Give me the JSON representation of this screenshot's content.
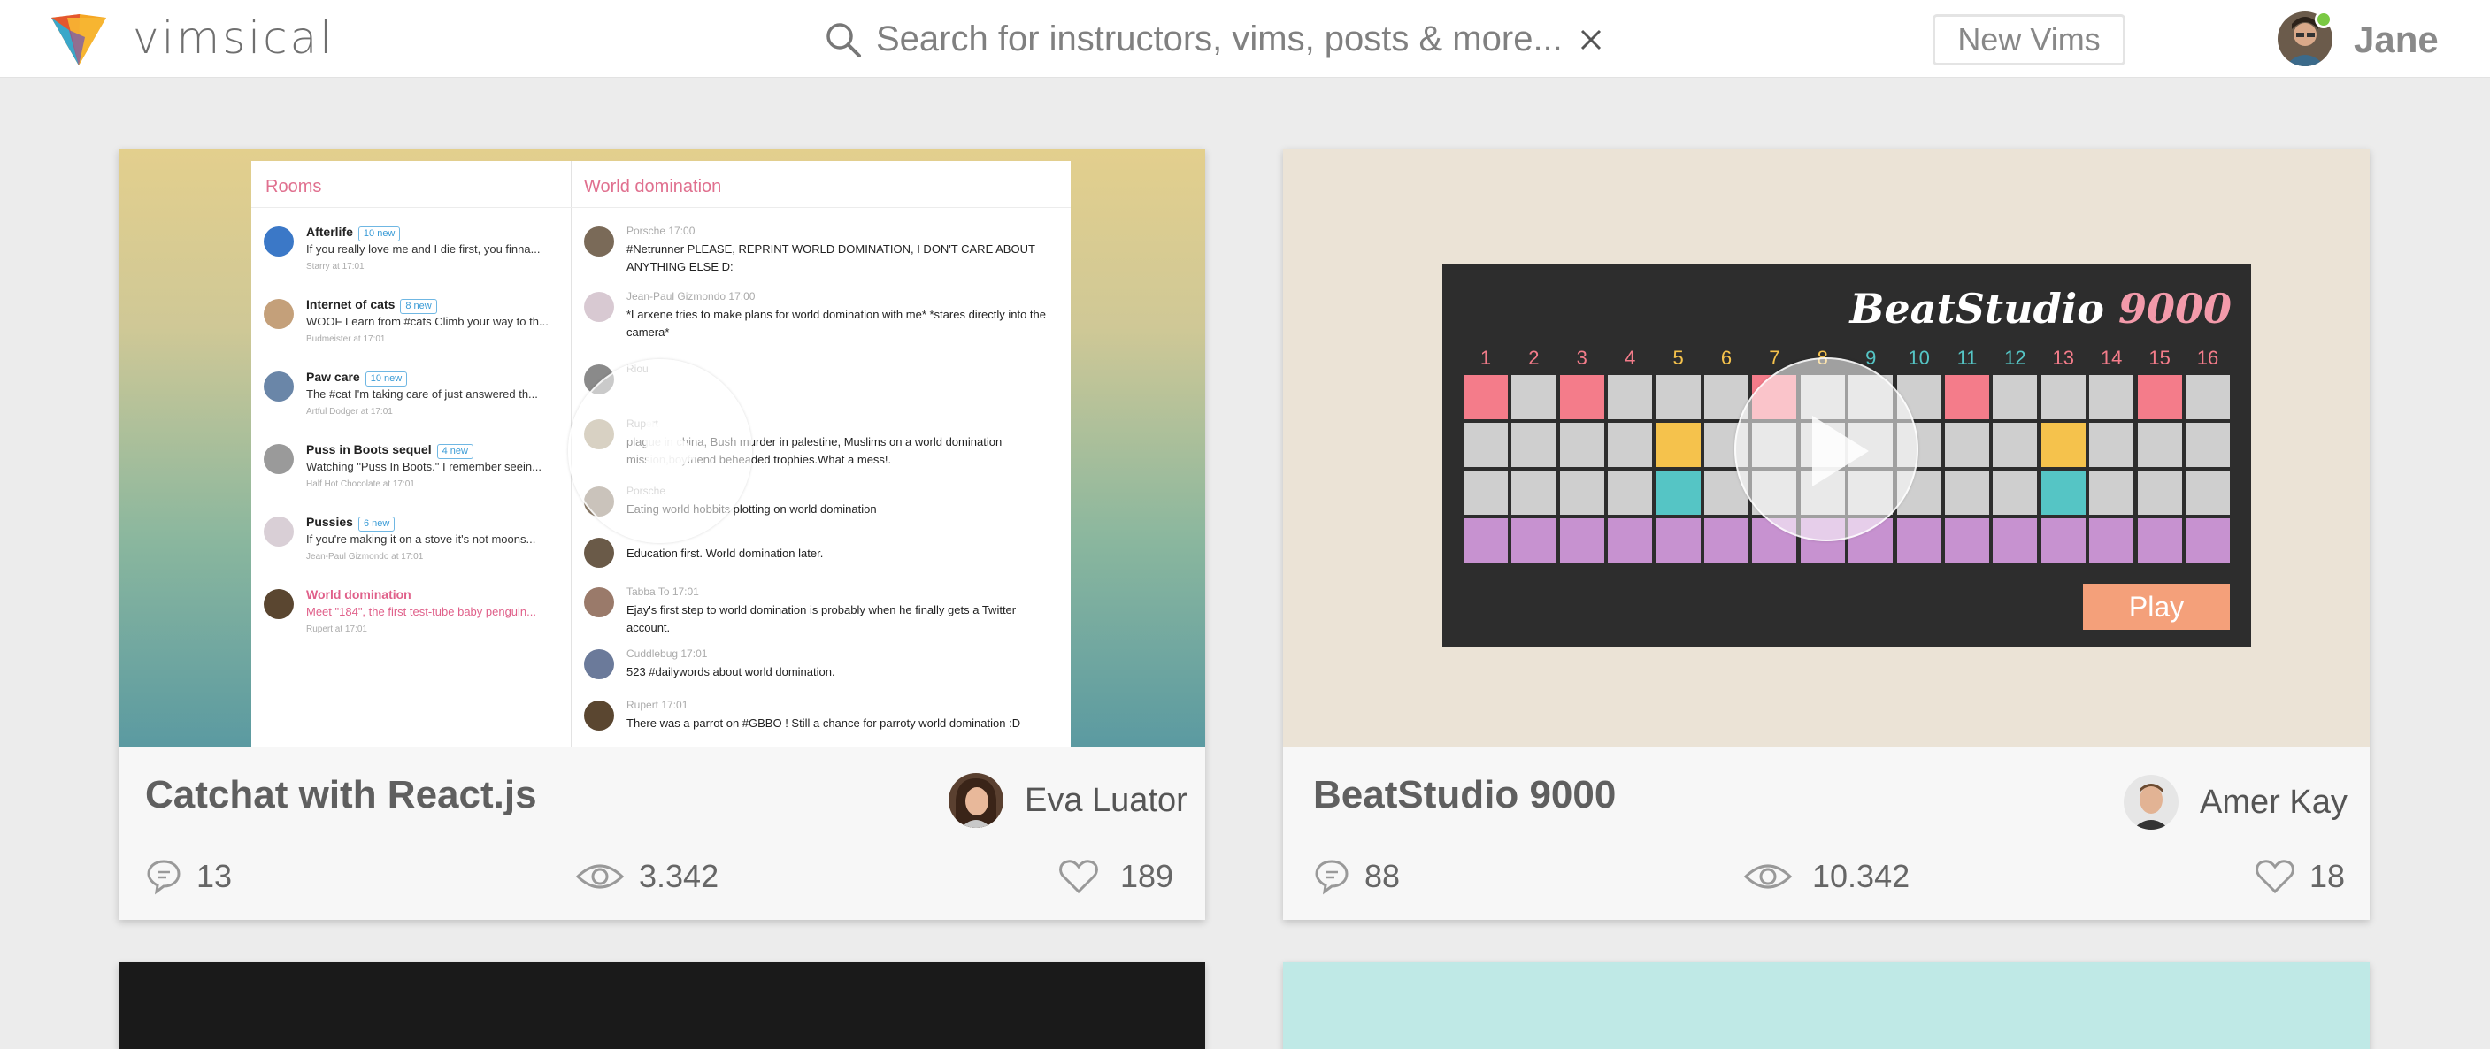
{
  "header": {
    "logo_text": "vimsical",
    "search_placeholder": "Search for instructors, vims, posts & more...",
    "new_vims_label": "New Vims",
    "user_name": "Jane"
  },
  "cards": [
    {
      "title": "Catchat with React.js",
      "author": "Eva Luator",
      "comments": "13",
      "views": "3.342",
      "likes": "189",
      "preview": {
        "rooms_header": "Rooms",
        "chat_header": "World domination",
        "rooms": [
          {
            "name": "Afterlife",
            "badge": "10 new",
            "preview": "If you really love me and I die first, you finna...",
            "meta": "Starry at 17:01",
            "color": "#3b78c7"
          },
          {
            "name": "Internet of cats",
            "badge": "8 new",
            "preview": "WOOF Learn from #cats Climb your way to th...",
            "meta": "Budmeister at 17:01",
            "color": "#c4a07a"
          },
          {
            "name": "Paw care",
            "badge": "10 new",
            "preview": "The #cat I'm taking care of just answered th...",
            "meta": "Artful Dodger at 17:01",
            "color": "#6a86a8"
          },
          {
            "name": "Puss in Boots sequel",
            "badge": "4 new",
            "preview": "Watching \"Puss In Boots.\" I remember seein...",
            "meta": "Half Hot Chocolate at 17:01",
            "color": "#9a9a9a"
          },
          {
            "name": "Pussies",
            "badge": "6 new",
            "preview": "If you're making it on a stove it's not moons...",
            "meta": "Jean-Paul Gizmondo at 17:01",
            "color": "#d9cfd6"
          },
          {
            "name": "World domination",
            "badge": "",
            "preview": "Meet \"184\", the first test-tube baby penguin...",
            "meta": "Rupert at 17:01",
            "color": "#5a4630"
          }
        ],
        "messages": [
          {
            "author": "Porsche 17:00",
            "text": "#Netrunner PLEASE, REPRINT WORLD DOMINATION, I DON'T CARE ABOUT ANYTHING ELSE D:",
            "color": "#7a6a58"
          },
          {
            "author": "Jean-Paul Gizmondo 17:00",
            "text": "*Larxene tries to make plans for world domination with me* *stares directly into the camera*",
            "color": "#d8c9d2"
          },
          {
            "author": "Riou",
            "text": "",
            "color": "#8a8a8a"
          },
          {
            "author": "Rupert",
            "text": "plague in china, Bush murder in palestine, Muslims on a world domination mission,boyfriend beheaded trophies.What a mess!.",
            "color": "#a89a7a"
          },
          {
            "author": "Porsche",
            "text": "Eating world hobbits plotting on world domination",
            "color": "#8a7a68"
          },
          {
            "author": "",
            "text": "Education first. World domination later.",
            "color": "#6a5a48"
          },
          {
            "author": "Tabba To 17:01",
            "text": "Ejay's first step to world domination is probably when he finally gets a Twitter account.",
            "color": "#9a7a6a"
          },
          {
            "author": "Cuddlebug 17:01",
            "text": "523 #dailywords about world domination.",
            "color": "#6b7a9a"
          },
          {
            "author": "Rupert 17:01",
            "text": "There was a parrot on #GBBO ! Still a chance for parroty world domination :D",
            "color": "#5a4630"
          }
        ]
      }
    },
    {
      "title": "BeatStudio 9000",
      "author": "Amer Kay",
      "comments": "88",
      "views": "10.342",
      "likes": "18",
      "preview": {
        "logo_word": "BeatStudio",
        "logo_number": "9000",
        "play_label": "Play",
        "step_numbers": [
          "1",
          "2",
          "3",
          "4",
          "5",
          "6",
          "7",
          "8",
          "9",
          "10",
          "11",
          "12",
          "13",
          "14",
          "15",
          "16"
        ],
        "step_colors": [
          "#f47c8a",
          "#f47c8a",
          "#f47c8a",
          "#f47c8a",
          "#f5c24c",
          "#f5c24c",
          "#f5c24c",
          "#f5c24c",
          "#55c5c5",
          "#55c5c5",
          "#55c5c5",
          "#55c5c5",
          "#f47c8a",
          "#f47c8a",
          "#f47c8a",
          "#f47c8a"
        ],
        "grid_rows": [
          [
            "#f47c8a",
            "",
            "#f47c8a",
            "",
            "",
            "",
            "#f47c8a",
            "",
            "",
            "",
            "#f47c8a",
            "",
            "",
            "",
            "#f47c8a",
            ""
          ],
          [
            "",
            "",
            "",
            "",
            "#f5c24c",
            "",
            "",
            "",
            "",
            "",
            "",
            "",
            "#f5c24c",
            "",
            "",
            ""
          ],
          [
            "",
            "",
            "",
            "",
            "#55c5c5",
            "",
            "",
            "",
            "",
            "",
            "",
            "",
            "#55c5c5",
            "",
            "",
            ""
          ],
          [
            "#c792d0",
            "#c792d0",
            "#c792d0",
            "#c792d0",
            "#c792d0",
            "#c792d0",
            "#c792d0",
            "#c792d0",
            "#c792d0",
            "#c792d0",
            "#c792d0",
            "#c792d0",
            "#c792d0",
            "#c792d0",
            "#c792d0",
            "#c792d0"
          ]
        ]
      }
    }
  ],
  "colors": {
    "accent_pink": "#e0708f",
    "online_green": "#7ac943",
    "play_orange": "#f4a07a"
  }
}
